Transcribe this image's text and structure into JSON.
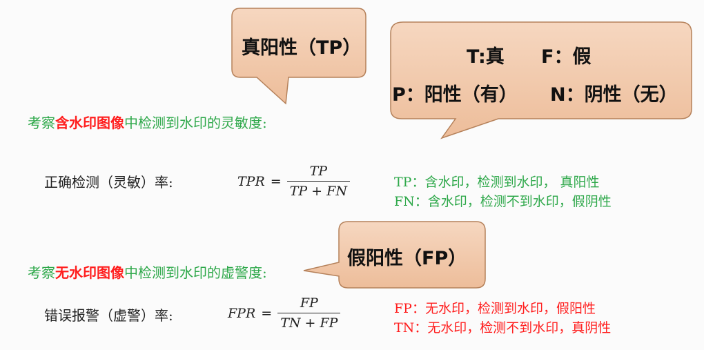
{
  "callouts": {
    "tp": {
      "label": "真阳性（TP）"
    },
    "legend": {
      "line1": {
        "t": "T:真",
        "f": "F：假"
      },
      "line2": {
        "p": "P：阳性（有）",
        "n": "N：阴性（无）"
      }
    },
    "fp": {
      "label": "假阳性（FP）"
    }
  },
  "section_tpr": {
    "heading_prefix": "考察",
    "heading_highlight": "含水印图像",
    "heading_suffix": "中检测到水印的灵敏度:",
    "label": "正确检测（灵敏）率:",
    "formula": {
      "lhs": "TPR",
      "eq": "=",
      "num": "TP",
      "den": "TP + FN"
    },
    "notes": [
      "TP：含水印，检测到水印，    真阳性",
      "FN：含水印，检测不到水印，假阴性"
    ]
  },
  "section_fpr": {
    "heading_prefix": "考察",
    "heading_highlight": "无水印图像",
    "heading_suffix": "中检测到水印的虚警度:",
    "label": "错误报警（虚警）率:",
    "formula": {
      "lhs": "FPR",
      "eq": "=",
      "num": "FP",
      "den": "TN + FP"
    },
    "notes": [
      "FP：无水印，检测到水印，假阳性",
      "TN：无水印，检测不到水印，真阴性"
    ]
  },
  "colors": {
    "bubble_fill": "#f1c7a8",
    "bubble_stroke": "#b5815a",
    "green": "#2ea84a",
    "red": "#ff1e1e",
    "text": "#222222"
  }
}
